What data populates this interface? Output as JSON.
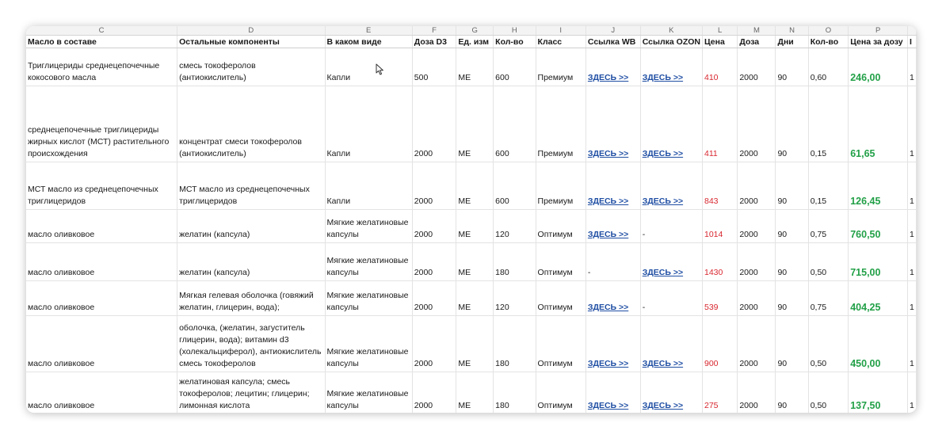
{
  "columns": [
    {
      "letter": "C",
      "header": "Масло в составе"
    },
    {
      "letter": "D",
      "header": "Остальные компоненты"
    },
    {
      "letter": "E",
      "header": "В каком виде"
    },
    {
      "letter": "F",
      "header": "Доза D3"
    },
    {
      "letter": "G",
      "header": "Ед. изм"
    },
    {
      "letter": "H",
      "header": "Кол-во"
    },
    {
      "letter": "I",
      "header": "Класс"
    },
    {
      "letter": "J",
      "header": "Ссылка WB"
    },
    {
      "letter": "K",
      "header": "Ссылка OZON"
    },
    {
      "letter": "L",
      "header": "Цена"
    },
    {
      "letter": "M",
      "header": "Доза"
    },
    {
      "letter": "N",
      "header": "Дни"
    },
    {
      "letter": "O",
      "header": "Кол-во"
    },
    {
      "letter": "P",
      "header": "Цена за дозу"
    },
    {
      "letter": "",
      "header": "I"
    }
  ],
  "rows": [
    {
      "oil": "Триглицериды среднецепочечные кокосового масла",
      "components": "смесь токоферолов (антиокислитель)",
      "form": "Капли",
      "dose_d3": "500",
      "unit": "МЕ",
      "qty": "600",
      "cls": "Премиум",
      "wb": "ЗДЕСЬ >>",
      "ozon": "ЗДЕСЬ >>",
      "price": "410",
      "dose": "2000",
      "days": "90",
      "count": "0,60",
      "price_per_dose": "246,00",
      "extra": "1"
    },
    {
      "oil": "среднецепочечные триглицериды жирных кислот (МСТ) растительного происхождения",
      "components": "концентрат смеси токоферолов (антиокислитель)",
      "form": "Капли",
      "dose_d3": "2000",
      "unit": "МЕ",
      "qty": "600",
      "cls": "Премиум",
      "wb": "ЗДЕСЬ >>",
      "ozon": "ЗДЕСЬ >>",
      "price": "411",
      "dose": "2000",
      "days": "90",
      "count": "0,15",
      "price_per_dose": "61,65",
      "extra": "1"
    },
    {
      "oil": "МСТ масло из среднецепочечных триглицеридов",
      "components": "МСТ масло из среднецепочечных триглицеридов",
      "form": "Капли",
      "dose_d3": "2000",
      "unit": "МЕ",
      "qty": "600",
      "cls": "Премиум",
      "wb": "ЗДЕСЬ >>",
      "ozon": "ЗДЕСЬ >>",
      "price": "843",
      "dose": "2000",
      "days": "90",
      "count": "0,15",
      "price_per_dose": "126,45",
      "extra": "1"
    },
    {
      "oil": "масло оливковое",
      "components": "желатин (капсула)",
      "form": "Мягкие желатиновые капсулы",
      "dose_d3": "2000",
      "unit": "МЕ",
      "qty": "120",
      "cls": "Оптимум",
      "wb": "ЗДЕСЬ >>",
      "ozon": "-",
      "price": "1014",
      "dose": "2000",
      "days": "90",
      "count": "0,75",
      "price_per_dose": "760,50",
      "extra": "1"
    },
    {
      "oil": "масло оливковое",
      "components": "желатин (капсула)",
      "form": "Мягкие желатиновые капсулы",
      "dose_d3": "2000",
      "unit": "МЕ",
      "qty": "180",
      "cls": "Оптимум",
      "wb": "-",
      "ozon": "ЗДЕСЬ >>",
      "price": "1430",
      "dose": "2000",
      "days": "90",
      "count": "0,50",
      "price_per_dose": "715,00",
      "extra": "1"
    },
    {
      "oil": "масло оливковое",
      "components": "Мягкая гелевая оболочка (говяжий желатин, глицерин, вода);",
      "form": "Мягкие желатиновые капсулы",
      "dose_d3": "2000",
      "unit": "МЕ",
      "qty": "120",
      "cls": "Оптимум",
      "wb": "ЗДЕСЬ >>",
      "ozon": "-",
      "price": "539",
      "dose": "2000",
      "days": "90",
      "count": "0,75",
      "price_per_dose": "404,25",
      "extra": "1"
    },
    {
      "oil": "масло оливковое",
      "components": "оболочка, (желатин, загуститель глицерин, вода); витамин d3 (холекальциферол), антиокислитель смесь токоферолов",
      "form": "Мягкие желатиновые капсулы",
      "dose_d3": "2000",
      "unit": "МЕ",
      "qty": "180",
      "cls": "Оптимум",
      "wb": "ЗДЕСЬ >>",
      "ozon": "ЗДЕСЬ >>",
      "price": "900",
      "dose": "2000",
      "days": "90",
      "count": "0,50",
      "price_per_dose": "450,00",
      "extra": "1"
    },
    {
      "oil": "масло оливковое",
      "components": "желатиновая капсула; смесь токоферолов; лецитин; глицерин; лимонная кислота",
      "form": "Мягкие желатиновые капсулы",
      "dose_d3": "2000",
      "unit": "МЕ",
      "qty": "180",
      "cls": "Оптимум",
      "wb": "ЗДЕСЬ >>",
      "ozon": "ЗДЕСЬ >>",
      "price": "275",
      "dose": "2000",
      "days": "90",
      "count": "0,50",
      "price_per_dose": "137,50",
      "extra": "1"
    }
  ],
  "colors": {
    "link": "#1f4ea3",
    "price": "#d8272f",
    "price_per_dose": "#22a047",
    "grid": "#e3e3e3"
  },
  "icons": {
    "cursor": "mouse-pointer-icon"
  }
}
